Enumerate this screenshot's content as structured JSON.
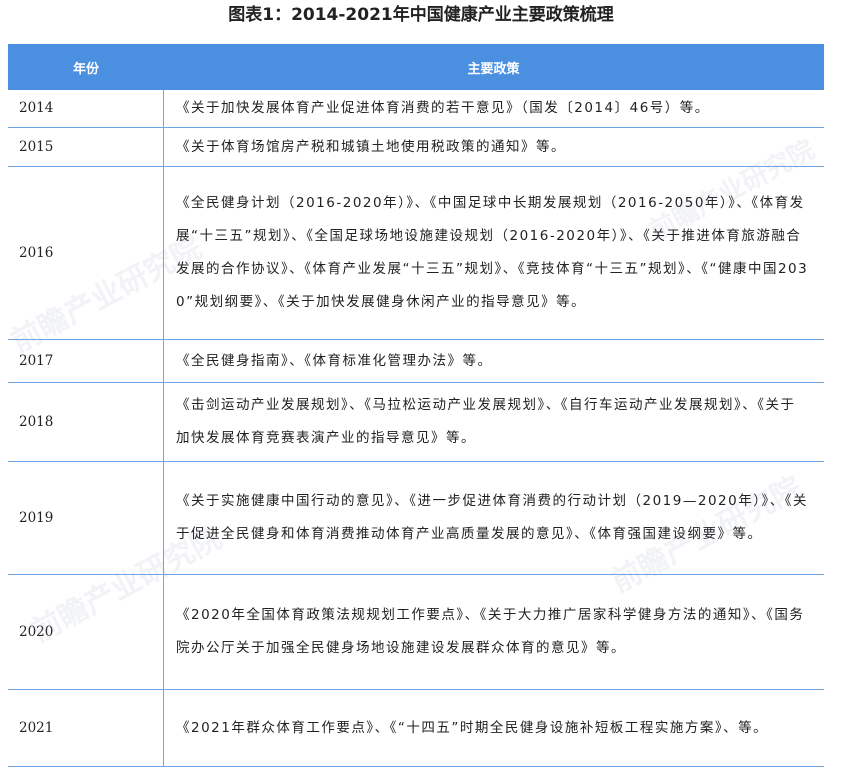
{
  "title": "图表1：2014-2021年中国健康产业主要政策梳理",
  "header": {
    "year": "年份",
    "policy": "主要政策"
  },
  "rows": [
    {
      "year": "2014",
      "policy": "《关于加快发展体育产业促进体育消费的若干意见》（国发〔2014〕46号）等。"
    },
    {
      "year": "2015",
      "policy": "《关于体育场馆房产税和城镇土地使用税政策的通知》等。"
    },
    {
      "year": "2016",
      "policy": "《全民健身计划（2016-2020年）》、《中国足球中长期发展规划（2016-2050年）》、《体育发展“十三五”规划》、《全国足球场地设施建设规划（2016-2020年）》、《关于推进体育旅游融合发展的合作协议》、《体育产业发展“十三五”规划》、《竞技体育“十三五”规划》、《“健康中国2030”规划纲要》、《关于加快发展健身休闲产业的指导意见》等。"
    },
    {
      "year": "2017",
      "policy": "《全民健身指南》、《体育标准化管理办法》等。"
    },
    {
      "year": "2018",
      "policy": "《击剑运动产业发展规划》、《马拉松运动产业发展规划》、《自行车运动产业发展规划》、《关于加快发展体育竞赛表演产业的指导意见》等。"
    },
    {
      "year": "2019",
      "policy": "《关于实施健康中国行动的意见》、《进一步促进体育消费的行动计划（2019—2020年）》、《关于促进全民健身和体育消费推动体育产业高质量发展的意见》、《体育强国建设纲要》等。"
    },
    {
      "year": "2020",
      "policy": "《2020年全国体育政策法规规划工作要点》、《关于大力推广居家科学健身方法的通知》、《国务院办公厅关于加强全民健身场地设施建设发展群众体育的意见》等。"
    },
    {
      "year": "2021",
      "policy": "《2021年群众体育工作要点》、《“十四五”时期全民健身设施补短板工程实施方案》、等。"
    }
  ],
  "watermark_text": "前瞻产业研究院"
}
